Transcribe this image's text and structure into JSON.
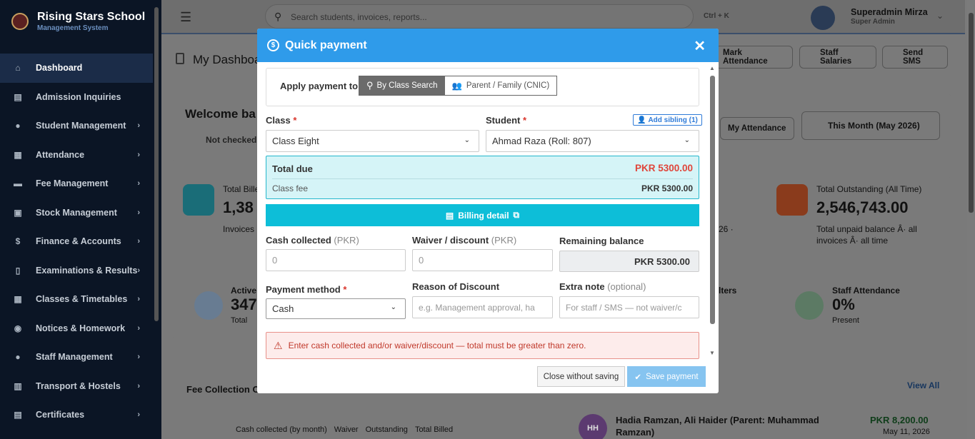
{
  "brand": {
    "title": "Rising Stars School",
    "subtitle": "Management System"
  },
  "sidebar": {
    "items": [
      {
        "label": "Dashboard",
        "icon": "home-icon",
        "glyph": "⌂",
        "chev": ""
      },
      {
        "label": "Admission Inquiries",
        "icon": "clipboard-icon",
        "glyph": "▤",
        "chev": ""
      },
      {
        "label": "Student Management",
        "icon": "user-icon",
        "glyph": "●",
        "chev": "›"
      },
      {
        "label": "Attendance",
        "icon": "calendar-icon",
        "glyph": "▦",
        "chev": "›"
      },
      {
        "label": "Fee Management",
        "icon": "wallet-icon",
        "glyph": "▬",
        "chev": "›"
      },
      {
        "label": "Stock Management",
        "icon": "box-icon",
        "glyph": "▣",
        "chev": "›"
      },
      {
        "label": "Finance & Accounts",
        "icon": "dollar-icon",
        "glyph": "$",
        "chev": "›"
      },
      {
        "label": "Examinations & Results",
        "icon": "document-icon",
        "glyph": "▯",
        "chev": "›"
      },
      {
        "label": "Classes & Timetables",
        "icon": "grid-icon",
        "glyph": "▦",
        "chev": "›"
      },
      {
        "label": "Notices & Homework",
        "icon": "chat-icon",
        "glyph": "◉",
        "chev": "›"
      },
      {
        "label": "Staff Management",
        "icon": "users-icon",
        "glyph": "●",
        "chev": "›"
      },
      {
        "label": "Transport & Hostels",
        "icon": "bus-icon",
        "glyph": "▥",
        "chev": "›"
      },
      {
        "label": "Certificates",
        "icon": "certificate-icon",
        "glyph": "▤",
        "chev": "›"
      }
    ]
  },
  "topbar": {
    "search_placeholder": "Search students, invoices, reports...",
    "shortcut": "Ctrl + K",
    "user_name": "Superadmin Mirza",
    "user_role": "Super Admin"
  },
  "background": {
    "title": "My Dashboa",
    "mark_attendance": "Mark Attendance",
    "staff_salaries": "Staff Salaries",
    "send_sms": "Send SMS",
    "welcome": "Welcome ba",
    "not_checked": "Not checked i",
    "my_attendance": "My Attendance",
    "month_filter": "This Month (May 2026)",
    "total_billed_label": "Total Bille",
    "total_billed_value": "1,38",
    "invoices_text": "Invoices",
    "date_fragment": "26 ·",
    "outstanding_label": "Total Outstanding (All Time)",
    "outstanding_value": "2,546,743.00",
    "outstanding_sub1": "Total unpaid balance Â· all",
    "outstanding_sub2": "invoices Â· all time",
    "active_label": "Active",
    "active_value": "347",
    "active_sub": "Total",
    "filters_fragment": "lters",
    "staff_att_label": "Staff Attendance",
    "staff_att_value": "0%",
    "staff_att_sub": "Present",
    "fee_collection": "Fee Collection Ov",
    "view_all": "View All",
    "legend": [
      "Cash collected (by month)",
      "Waiver",
      "Outstanding",
      "Total Billed"
    ],
    "recent_initials": "HH",
    "recent_name": "Hadia Ramzan, Ali Haider (Parent: Muhammad",
    "recent_name2": "Ramzan)",
    "recent_amount": "PKR 8,200.00",
    "recent_date": "May 11, 2026"
  },
  "modal": {
    "title": "Quick payment",
    "close": "✕",
    "apply_label": "Apply payment to",
    "tab_class": "By Class Search",
    "tab_parent": "Parent / Family (CNIC)",
    "class_label": "Class",
    "class_value": "Class Eight",
    "student_label": "Student",
    "student_value": "Ahmad Raza (Roll: 807)",
    "add_sibling": "Add sibling (1)",
    "total_due_label": "Total due",
    "total_due_value": "PKR 5300.00",
    "class_fee_label": "Class fee",
    "class_fee_value": "PKR 5300.00",
    "billing_detail": "Billing detail",
    "cash_label": "Cash collected",
    "cash_unit": "(PKR)",
    "cash_placeholder": "0",
    "waiver_label": "Waiver / discount",
    "waiver_unit": "(PKR)",
    "waiver_placeholder": "0",
    "remaining_label": "Remaining balance",
    "remaining_value": "PKR 5300.00",
    "method_label": "Payment method",
    "method_value": "Cash",
    "reason_label": "Reason of Discount",
    "reason_placeholder": "e.g. Management approval, ha",
    "note_label": "Extra note",
    "note_hint": "(optional)",
    "note_placeholder": "For staff / SMS — not waiver/c",
    "alert": "Enter cash collected and/or waiver/discount — total must be greater than zero.",
    "close_btn": "Close without saving",
    "save_btn": "Save payment",
    "req": "*"
  }
}
